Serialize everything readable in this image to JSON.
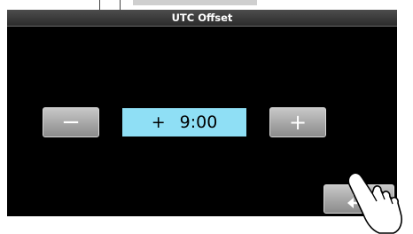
{
  "window": {
    "title": "UTC Offset"
  },
  "offset": {
    "sign": "+",
    "value": "9:00"
  },
  "buttons": {
    "decrease_label": "−",
    "increase_label": "+"
  },
  "icons": {
    "back": "return-arrow-icon",
    "pointer": "pointing-hand-icon"
  },
  "colors": {
    "value_background": "#8fdff5",
    "screen_background": "#000000"
  }
}
